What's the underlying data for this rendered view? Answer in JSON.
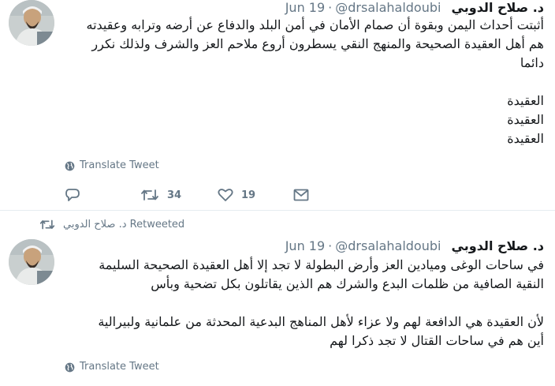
{
  "tweets": [
    {
      "author_name": "د. صلاح الدوبي",
      "handle": "@drsalahaldoubi",
      "separator": "·",
      "date": "Jun 19",
      "lines": [
        "أثبتت أحداث اليمن وبقوة أن صمام الأمان في أمن البلد والدفاع عن أرضه وترابه وعقيدته",
        "هم أهل العقيدة الصحيحة والمنهج النقي يسطرون أروع ملاحم العز والشرف ولذلك نكرر",
        "دائما",
        "",
        "العقيدة",
        "العقيدة",
        "العقيدة"
      ],
      "translate_label": "Translate Tweet",
      "reply_count": "",
      "retweet_count": "34",
      "like_count": "19"
    },
    {
      "retweeted_by": "د. صلاح الدوبي",
      "retweeted_label": "Retweeted",
      "author_name": "د. صلاح الدوبي",
      "handle": "@drsalahaldoubi",
      "separator": "·",
      "date": "Jun 19",
      "lines": [
        "في ساحات الوغى وميادين العز وأرض البطولة لا تجد إلا أهل العقيدة الصحيحة السليمة",
        "النقية الصافية من ظلمات البدع والشرك هم الذين يقاتلون بكل تضحية وبأس",
        "",
        "لأن العقيدة هي الدافعة لهم ولا عزاء لأهل المناهج البدعية المحدثة من علمانية ولبيرالية",
        "أين هم في ساحات القتال لا تجد ذكرا لهم"
      ],
      "translate_label": "Translate Tweet"
    }
  ],
  "icons": {
    "avatar": "avatar-photo",
    "chevron": "chevron-down-icon",
    "globe": "globe-icon",
    "reply": "reply-icon",
    "retweet": "retweet-icon",
    "like": "heart-icon",
    "dm": "envelope-icon"
  },
  "colors": {
    "text": "#14171a",
    "muted": "#657786",
    "border": "#e6ecf0"
  }
}
